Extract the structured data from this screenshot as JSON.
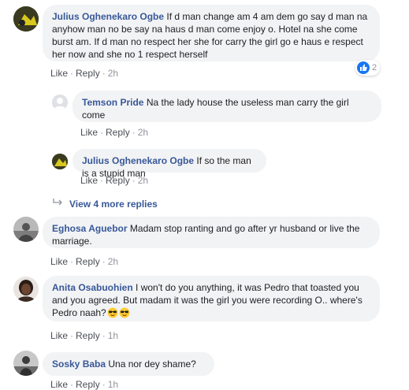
{
  "comments": [
    {
      "author": "Julius Oghenekaro Ogbe",
      "text": "If d man change am 4 am dem go say d man na anyhow man no be say na haus d man come enjoy o. Hotel na she come burst am. If d man no respect her she for carry the girl go e haus e respect her now and she no 1 respect herself",
      "like": "Like",
      "reply": "Reply",
      "time": "2h",
      "reactions": {
        "icon": "like-icon",
        "count": "2"
      }
    },
    {
      "author": "Temson Pride",
      "text": "Na the lady house the useless man carry the girl come",
      "like": "Like",
      "reply": "Reply",
      "time": "2h"
    },
    {
      "author": "Julius Oghenekaro Ogbe",
      "text": "If so the man is a stupid man",
      "like": "Like",
      "reply": "Reply",
      "time": "2h"
    },
    {
      "author": "Eghosa Aguebor",
      "text": "Madam stop ranting and go after yr husband or live the marriage.",
      "like": "Like",
      "reply": "Reply",
      "time": "2h"
    },
    {
      "author": "Anita Osabuohien",
      "text": "I won't do you anything, it was Pedro that toasted you and you agreed. But madam it was the girl you were recording O.. where's Pedro naah?",
      "like": "Like",
      "reply": "Reply",
      "time": "1h"
    },
    {
      "author": "Sosky Baba",
      "text": "Una nor dey shame?",
      "like": "Like",
      "reply": "Reply",
      "time": "1h"
    }
  ],
  "view_more_replies": "View 4 more replies",
  "colors": {
    "link": "#385898",
    "bubble": "#f2f3f5",
    "meta": "#90949c",
    "like_blue": "#1877f2"
  }
}
